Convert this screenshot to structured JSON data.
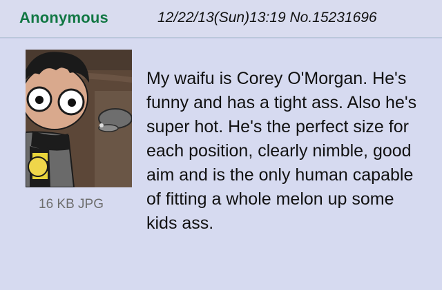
{
  "post": {
    "name": "Anonymous",
    "datetime": "12/22/13(Sun)13:19",
    "number": "No.15231696",
    "file": {
      "info": "16 KB JPG",
      "thumbnail_icon": "cartoon-character-thumbnail"
    },
    "comment": "My waifu is Corey O'Morgan. He's funny and has a tight ass. Also he's super hot. He's the perfect size for each position, clearly nimble, good aim and is the only human capable of fitting a whole melon up some kids ass."
  },
  "colors": {
    "background": "#d6daf0",
    "name": "#117743",
    "border": "#b7c5d9",
    "file_info": "#6e6e6e"
  }
}
